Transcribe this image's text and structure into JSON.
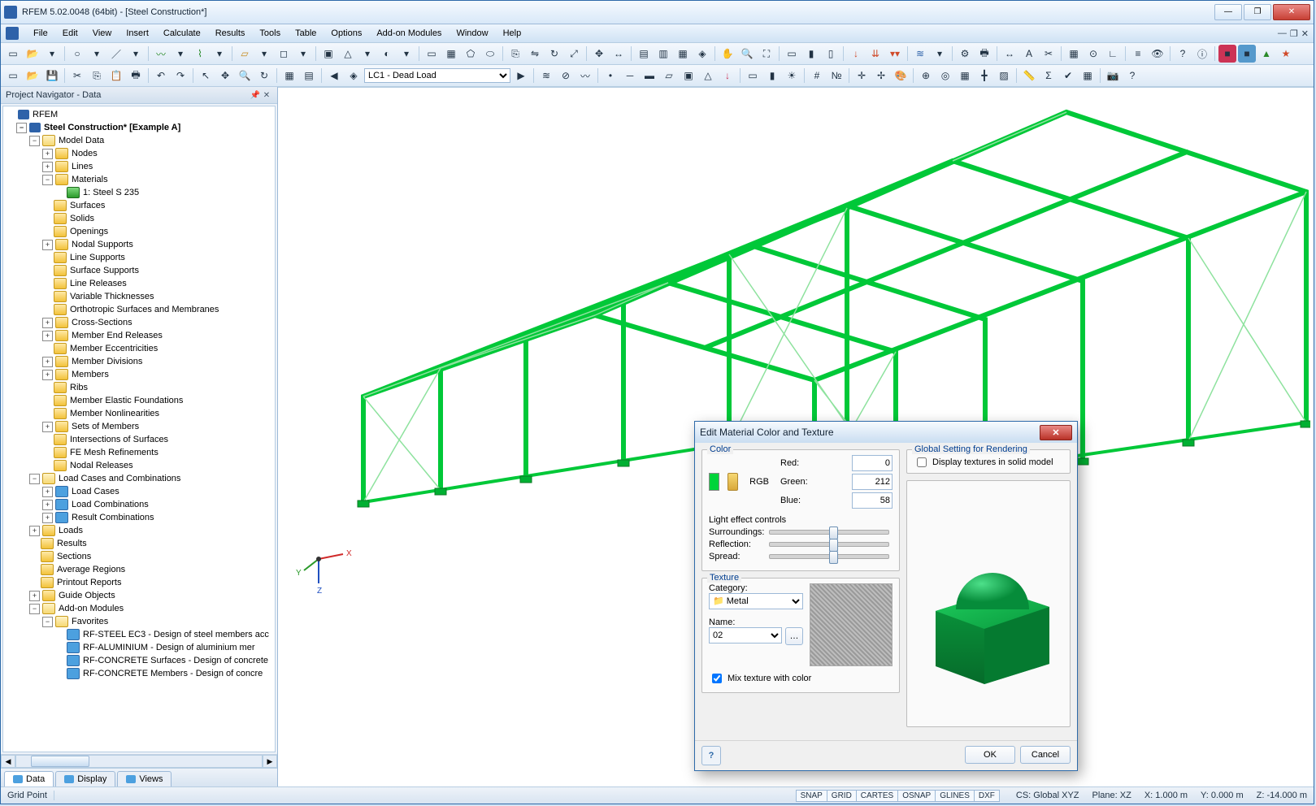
{
  "window": {
    "title": "RFEM 5.02.0048 (64bit) - [Steel Construction*]"
  },
  "menu": {
    "items": [
      "File",
      "Edit",
      "View",
      "Insert",
      "Calculate",
      "Results",
      "Tools",
      "Table",
      "Options",
      "Add-on Modules",
      "Window",
      "Help"
    ]
  },
  "toolbar2": {
    "combo_value": "LC1 - Dead Load"
  },
  "navigator": {
    "title": "Project Navigator - Data",
    "root": "RFEM",
    "project": "Steel Construction* [Example A]",
    "model_data": "Model Data",
    "model_items": [
      "Nodes",
      "Lines",
      "Materials"
    ],
    "material_item": "1: Steel S 235",
    "model_items2": [
      "Surfaces",
      "Solids",
      "Openings",
      "Nodal Supports",
      "Line Supports",
      "Surface Supports",
      "Line Releases",
      "Variable Thicknesses",
      "Orthotropic Surfaces and Membranes",
      "Cross-Sections",
      "Member End Releases",
      "Member Eccentricities",
      "Member Divisions",
      "Members",
      "Ribs",
      "Member Elastic Foundations",
      "Member Nonlinearities",
      "Sets of Members",
      "Intersections of Surfaces",
      "FE Mesh Refinements",
      "Nodal Releases"
    ],
    "load_cases": "Load Cases and Combinations",
    "load_items": [
      "Load Cases",
      "Load Combinations",
      "Result Combinations"
    ],
    "other": [
      "Loads",
      "Results",
      "Sections",
      "Average Regions",
      "Printout Reports",
      "Guide Objects",
      "Add-on Modules"
    ],
    "favorites": "Favorites",
    "fav_items": [
      "RF-STEEL EC3 - Design of steel members acc",
      "RF-ALUMINIUM - Design of aluminium mer",
      "RF-CONCRETE Surfaces - Design of concrete",
      "RF-CONCRETE Members - Design of concre"
    ],
    "tabs": {
      "data": "Data",
      "display": "Display",
      "views": "Views"
    }
  },
  "dialog": {
    "title": "Edit Material Color and Texture",
    "color_group": "Color",
    "rgb_label": "RGB",
    "red_label": "Red:",
    "green_label": "Green:",
    "blue_label": "Blue:",
    "red": "0",
    "green": "212",
    "blue": "58",
    "lightfx": "Light effect controls",
    "surroundings": "Surroundings:",
    "reflection": "Reflection:",
    "spread": "Spread:",
    "texture_group": "Texture",
    "category_label": "Category:",
    "category_value": "Metal",
    "name_label": "Name:",
    "name_value": "02",
    "mix_label": "Mix texture with color",
    "render_group": "Global Setting for Rendering",
    "display_tex_label": "Display textures in solid model",
    "ok": "OK",
    "cancel": "Cancel"
  },
  "canvas": {
    "axis_x": "X",
    "axis_y": "Y",
    "axis_z": "Z"
  },
  "statusbar": {
    "left": "Grid Point",
    "snaps": [
      "SNAP",
      "GRID",
      "CARTES",
      "OSNAP",
      "GLINES",
      "DXF"
    ],
    "cs": "CS: Global XYZ",
    "plane": "Plane: XZ",
    "x": "X: 1.000 m",
    "y": "Y: 0.000 m",
    "z": "Z: -14.000 m"
  }
}
